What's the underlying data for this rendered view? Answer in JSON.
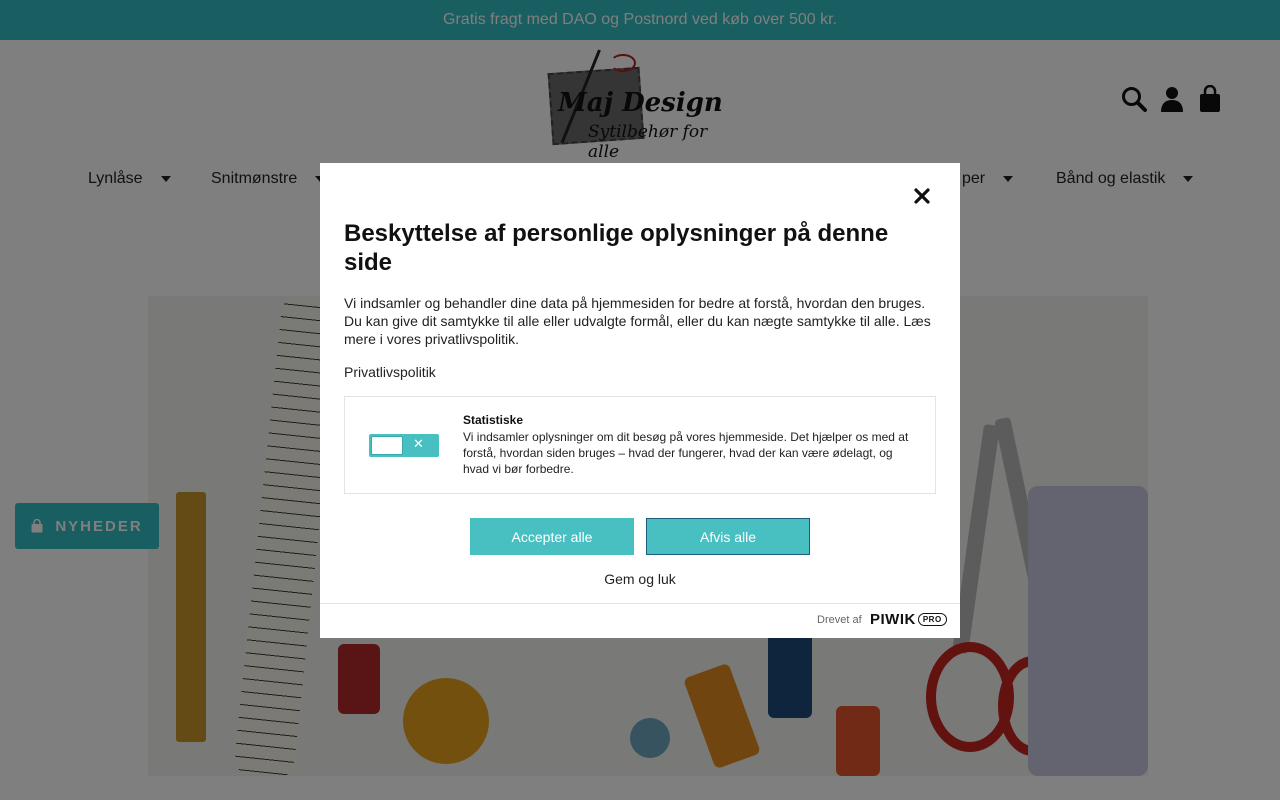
{
  "announcement": {
    "text": "Gratis fragt med DAO og Postnord ved køb over 500 kr."
  },
  "header": {
    "logo": {
      "title": "Maj Design",
      "subtitle": "Sytilbehør for alle"
    },
    "icons": [
      "search-icon",
      "user-icon",
      "bag-icon"
    ]
  },
  "nav": {
    "items": [
      {
        "label": "Lynlåse"
      },
      {
        "label": "Snitmønstre"
      },
      {
        "label": "per"
      },
      {
        "label": "Bånd og elastik"
      }
    ]
  },
  "news_button": {
    "label": "NYHEDER",
    "icon": "bag-icon"
  },
  "modal": {
    "title": "Beskyttelse af personlige oplysninger på denne side",
    "text": "Vi indsamler og behandler dine data på hjemmesiden for bedre at forstå, hvordan den bruges. Du kan give dit samtykke til alle eller udvalgte formål, eller du kan nægte samtykke til alle. Læs mere i vores privatlivspolitik.",
    "privacy_link": "Privatlivspolitik",
    "consent": {
      "title": "Statistiske",
      "text": "Vi indsamler oplysninger om dit besøg på vores hjemmeside. Det hjælper os med at forstå, hvordan siden bruges – hvad der fungerer, hvad der kan være ødelagt, og hvad vi bør forbedre.",
      "toggle_on": false
    },
    "accept_label": "Accepter alle",
    "reject_label": "Afvis alle",
    "save_label": "Gem og luk",
    "powered_by": "Drevet af",
    "brand": {
      "name": "PIWIK",
      "suffix": "PRO"
    }
  },
  "colors": {
    "accent": "#33bcc0",
    "button": "#48c0c2",
    "overlay": "rgba(0,0,0,0.5)"
  }
}
